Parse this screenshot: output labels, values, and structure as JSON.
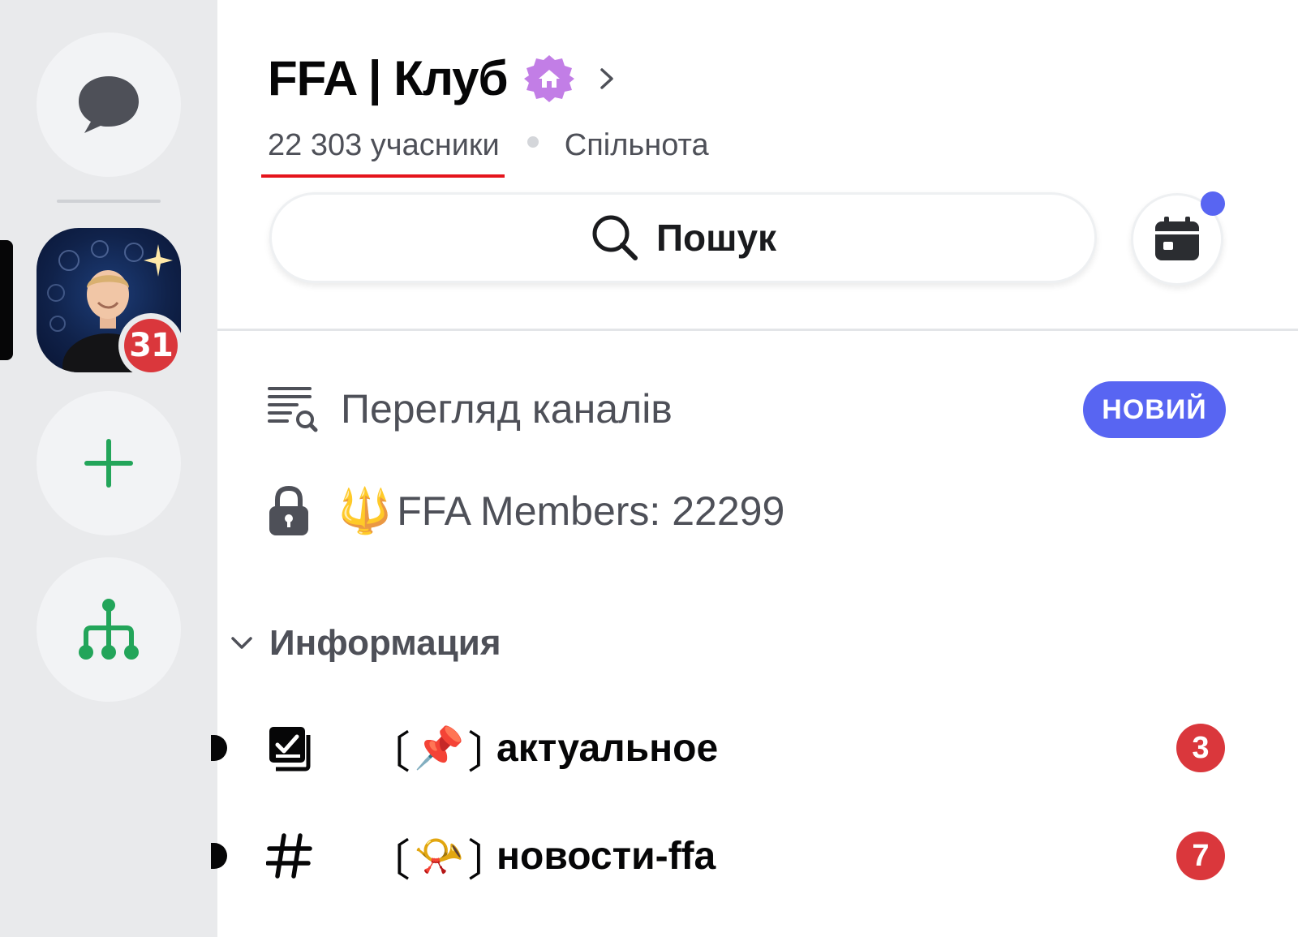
{
  "server": {
    "name": "FFA | Клуб",
    "members": "22 303 учасники",
    "type": "Спільнота",
    "badge_icon": "community-house-badge-icon"
  },
  "rail": {
    "server_mentions": "31",
    "items": [
      "messages-icon",
      "server-avatar",
      "add-server-icon",
      "discover-hub-icon"
    ]
  },
  "search": {
    "label": "Пошук"
  },
  "events": {
    "icon": "calendar-icon",
    "has_new": true
  },
  "browse_channels": {
    "label": "Перегляд каналів",
    "badge": "НОВИЙ"
  },
  "locked_channel": {
    "emoji": "🔱",
    "label": "FFA Members: 22299"
  },
  "category": {
    "name": "Информация"
  },
  "channels": [
    {
      "icon": "rules-checkbox-icon",
      "bracket_open": "〔",
      "emoji": "📌",
      "bracket_close": "〕",
      "name": "актуальное",
      "mentions": "3"
    },
    {
      "icon": "hashtag-icon",
      "bracket_open": "〔",
      "emoji": "📯",
      "bracket_close": "〕",
      "name": "новости-ffa",
      "mentions": "7"
    }
  ],
  "colors": {
    "accent": "#5865f2",
    "mention_red": "#da373c",
    "green": "#23a55a",
    "underline_red": "#e5141c"
  }
}
